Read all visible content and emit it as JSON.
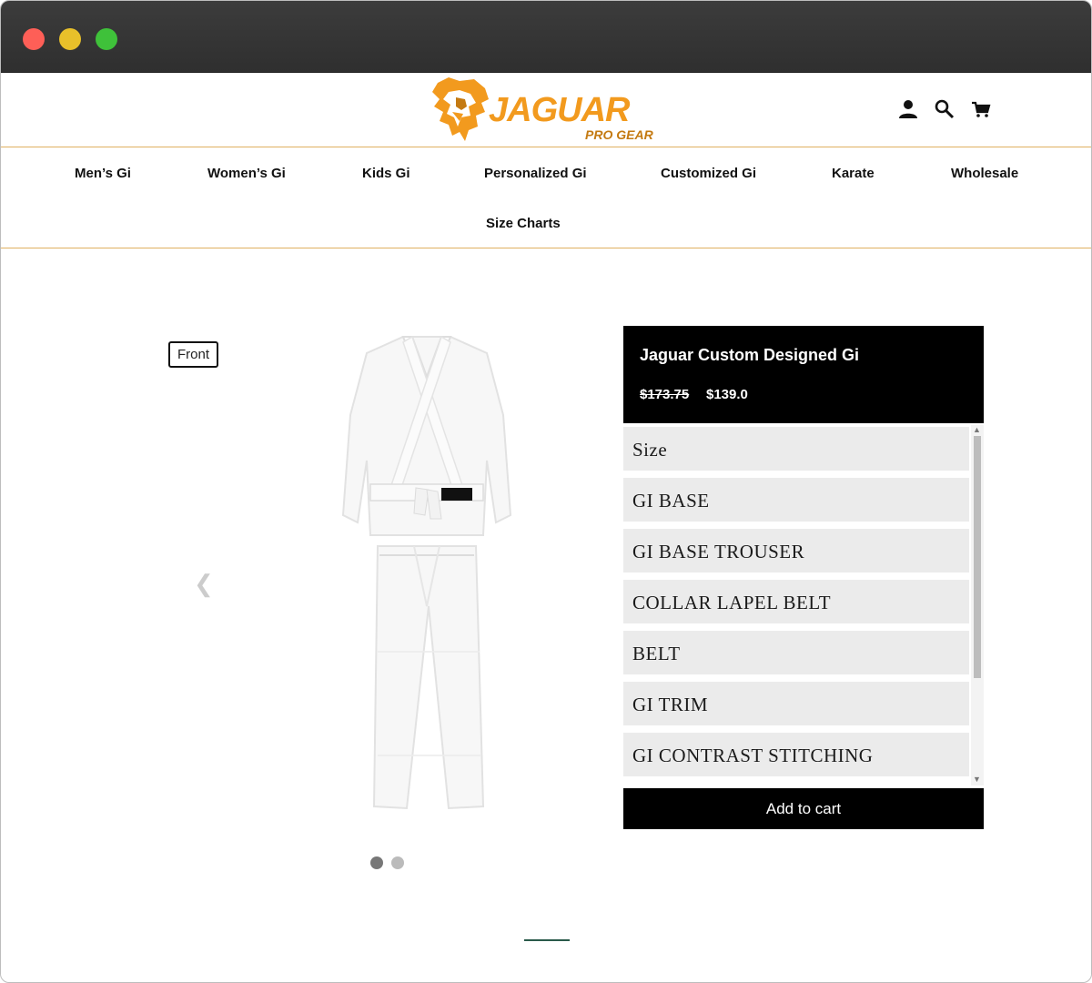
{
  "brand": {
    "name": "JAGUAR",
    "tagline": "PRO GEAR",
    "accent": "#f29a1e"
  },
  "header": {
    "icons": [
      "account-icon",
      "search-icon",
      "cart-icon"
    ]
  },
  "nav": {
    "items": [
      {
        "label": "Men’s Gi"
      },
      {
        "label": "Women’s Gi"
      },
      {
        "label": "Kids Gi"
      },
      {
        "label": "Personalized Gi"
      },
      {
        "label": "Customized Gi"
      },
      {
        "label": "Karate"
      },
      {
        "label": "Wholesale"
      },
      {
        "label": "Size Charts"
      }
    ]
  },
  "gallery": {
    "view_label": "Front",
    "prev_arrow": "❮",
    "next_arrow": "❯",
    "slides_total": 2,
    "slide_active": 1
  },
  "product": {
    "title": "Jaguar Custom Designed Gi",
    "price_original": "$173.75",
    "price_sale": "$139.0"
  },
  "options": {
    "items": [
      {
        "label": "Size"
      },
      {
        "label": "GI BASE"
      },
      {
        "label": "GI BASE TROUSER"
      },
      {
        "label": "COLLAR LAPEL BELT"
      },
      {
        "label": "BELT"
      },
      {
        "label": "GI TRIM"
      },
      {
        "label": "GI CONTRAST STITCHING"
      }
    ]
  },
  "cart": {
    "add_label": "Add to cart"
  }
}
